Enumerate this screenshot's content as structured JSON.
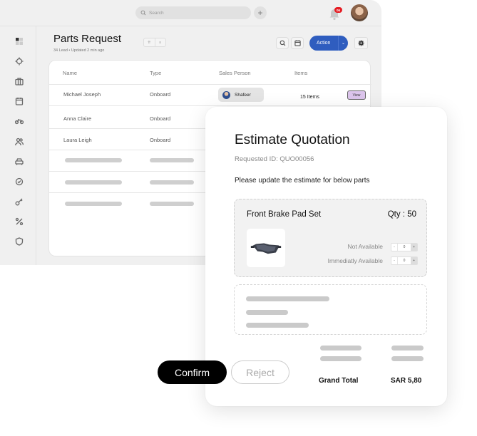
{
  "topbar": {
    "search_placeholder": "Search",
    "notification_count": "06"
  },
  "sidebar": {
    "items": [
      {
        "icon": "dashboard-icon"
      },
      {
        "icon": "target-icon"
      },
      {
        "icon": "briefcase-icon"
      },
      {
        "icon": "calendar-icon"
      },
      {
        "icon": "bike-icon"
      },
      {
        "icon": "users-icon"
      },
      {
        "icon": "car-icon"
      },
      {
        "icon": "check-badge-icon"
      },
      {
        "icon": "key-icon"
      },
      {
        "icon": "percent-icon"
      },
      {
        "icon": "shield-icon"
      }
    ]
  },
  "header": {
    "title": "Parts Request",
    "subtitle": "34 Lead • Updated 2 min ago",
    "action_label": "Action"
  },
  "table": {
    "columns": [
      "Name",
      "Type",
      "Sales Person",
      "Items"
    ],
    "rows": [
      {
        "name": "Michael Joseph",
        "type": "Onboard",
        "sales_person": "Shafeer",
        "items": "15 Items",
        "action": "View"
      },
      {
        "name": "Anna Claire",
        "type": "Onboard"
      },
      {
        "name": "Laura Leigh",
        "type": "Onboard"
      }
    ]
  },
  "quotation": {
    "title": "Estimate Quotation",
    "requested_id": "Requested ID: QUO00056",
    "message": "Please update the estimate for below parts",
    "part": {
      "name": "Front Brake Pad Set",
      "qty": "Qty : 50",
      "not_available_label": "Not Available",
      "not_available_value": "0",
      "immediately_available_label": "Immediatly Available",
      "immediately_available_value": "0"
    },
    "grand_total_label": "Grand Total",
    "grand_total_value": "SAR 5,80",
    "confirm_label": "Confirm",
    "reject_label": "Reject"
  }
}
